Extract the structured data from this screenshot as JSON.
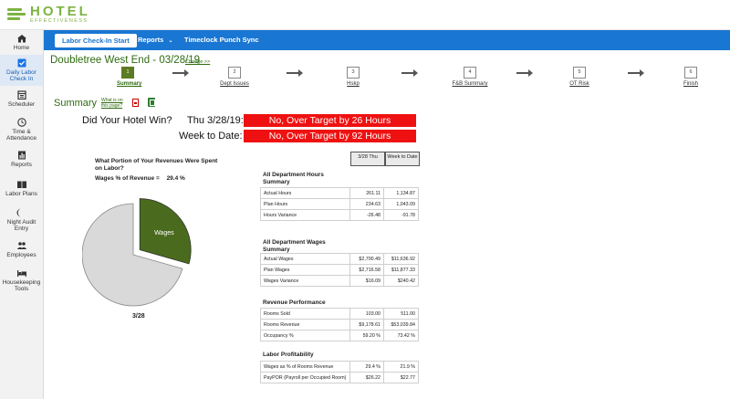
{
  "app": {
    "logo_main": "HOTEL",
    "logo_sub": "EFFECTIVENESS"
  },
  "sidebar": {
    "items": [
      {
        "label": "Home",
        "icon": "home-icon"
      },
      {
        "label": "Daily Labor Check In",
        "icon": "checkbox-icon",
        "active": true
      },
      {
        "label": "Scheduler",
        "icon": "calendar-icon"
      },
      {
        "label": "Time & Attendance",
        "icon": "clock-icon"
      },
      {
        "label": "Reports",
        "icon": "bar-chart-icon"
      },
      {
        "label": "Labor Plans",
        "icon": "book-icon"
      },
      {
        "label": "Night Audit Entry",
        "icon": "moon-icon"
      },
      {
        "label": "Employees",
        "icon": "people-icon"
      },
      {
        "label": "Housekeeping Tools",
        "icon": "bed-icon"
      }
    ]
  },
  "nav": {
    "start_label": "Labor Check-In Start",
    "reports_label": "Reports",
    "timeclock_label": "Timeclock Punch Sync"
  },
  "page": {
    "title": "Doubletree West End - 03/28/19",
    "change_link": "Change >>",
    "summary_title": "Summary",
    "what_link": "What is on this page?"
  },
  "steps": [
    {
      "num": "1",
      "label": "Summary",
      "active": true
    },
    {
      "num": "2",
      "label": "Dept Issues"
    },
    {
      "num": "3",
      "label": "Hskp"
    },
    {
      "num": "4",
      "label": "F&B Summary"
    },
    {
      "num": "5",
      "label": "OT Risk"
    },
    {
      "num": "6",
      "label": "Finish"
    }
  ],
  "result": {
    "question": "Did Your Hotel Win?",
    "day_label": "Thu 3/28/19:",
    "day_result": "No, Over Target by 26 Hours",
    "week_label": "Week to Date:",
    "week_result": "No, Over Target by 92 Hours",
    "result_color": "#ef1111"
  },
  "pie": {
    "question": "What Portion of Your Revenues Were Spent on Labor?",
    "pct_label": "Wages % of Revenue =",
    "pct_value": "29.4 %",
    "slice_label": "Wages",
    "wages_fraction": 0.294,
    "date_label": "3/28",
    "wages_color": "#4a6b1e",
    "rest_color": "#d9d9d9"
  },
  "table": {
    "col1_head": "3/28 Thu",
    "col2_head": "Week to Date",
    "sections": [
      {
        "title": "All Department Hours Summary",
        "rows": [
          {
            "label": "Actual Hours",
            "v1": "261.11",
            "v2": "1,134.87"
          },
          {
            "label": "Plan Hours",
            "v1": "234.63",
            "v2": "1,043.09"
          },
          {
            "label": "Hours Variance",
            "v1": "-26.48",
            "v2": "-91.78"
          }
        ]
      },
      {
        "title": "All Department Wages Summary",
        "rows": [
          {
            "label": "Actual Wages",
            "v1": "$2,700.49",
            "v2": "$11,636.92"
          },
          {
            "label": "Plan Wages",
            "v1": "$2,716.58",
            "v2": "$11,877.33"
          },
          {
            "label": "Wages Variance",
            "v1": "$16.09",
            "v2": "$240.42"
          }
        ]
      },
      {
        "title": "Revenue Performance",
        "rows": [
          {
            "label": "Rooms Sold",
            "v1": "103.00",
            "v2": "511.00"
          },
          {
            "label": "Rooms Revenue",
            "v1": "$9,178.61",
            "v2": "$53,039.84"
          },
          {
            "label": "Occupancy %",
            "v1": "59.20 %",
            "v2": "73.42 %"
          }
        ]
      },
      {
        "title": "Labor Profitability",
        "rows": [
          {
            "label": "Wages as % of Rooms Revenue",
            "v1": "29.4 %",
            "v2": "21.9 %"
          },
          {
            "label": "PayPOR (Payroll per Occupied Room)",
            "v1": "$26.22",
            "v2": "$22.77"
          }
        ]
      }
    ]
  }
}
